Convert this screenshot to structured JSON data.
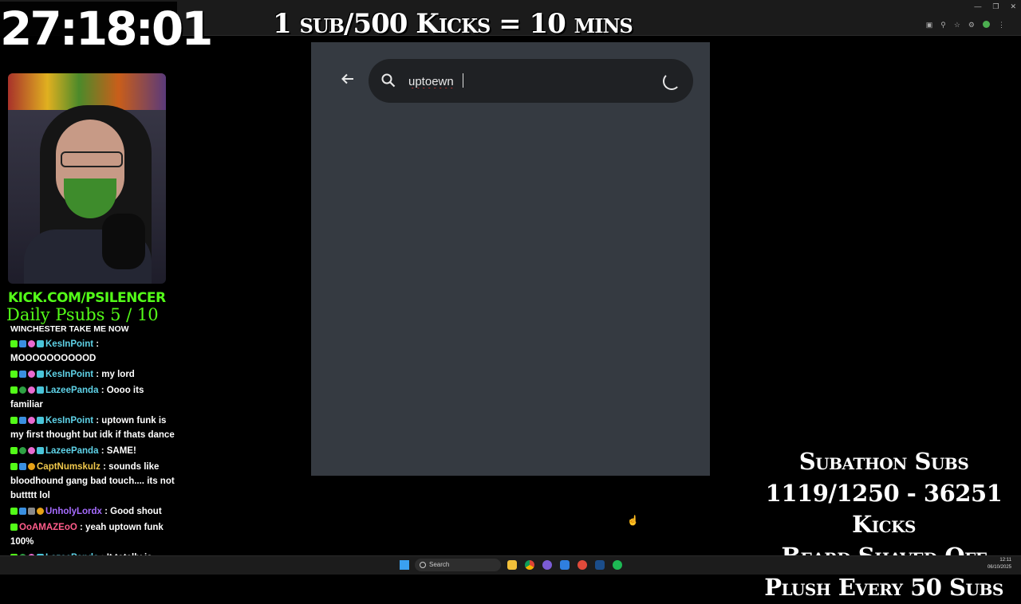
{
  "overlay": {
    "timer": "27:18:01",
    "goal_banner": "1 sub/500 Kicks = 10 mins",
    "kick_url": "KICK.COM/PSILENCER",
    "daily_psubs": "Daily Psubs 5 / 10",
    "subathon_lines": [
      "Subathon Subs",
      "1119/1250 - 36251 Kicks",
      "Beard Shaved Off",
      "Plush Every 50 Subs"
    ]
  },
  "chat": {
    "top_line": "WINCHESTER TAKE ME NOW",
    "messages": [
      {
        "user": "KesInPoint",
        "color": "#5fd3e8",
        "text": ": MOOOOOOOOOOD"
      },
      {
        "user": "KesInPoint",
        "color": "#5fd3e8",
        "text": ": my lord"
      },
      {
        "user": "LazeePanda",
        "color": "#5fd3e8",
        "text": ": Oooo its familiar"
      },
      {
        "user": "KesInPoint",
        "color": "#5fd3e8",
        "text": ": uptown funk is my first thought but idk if thats dance"
      },
      {
        "user": "LazeePanda",
        "color": "#5fd3e8",
        "text": ": SAME!"
      },
      {
        "user": "CaptNumskulz",
        "color": "#f2c94c",
        "text": ": sounds like bloodhound gang bad touch.... its not buttttt lol"
      },
      {
        "user": "UnholyLordx",
        "color": "#a66cff",
        "text": ": Good shout"
      },
      {
        "user": "OoAMAZEoO",
        "color": "#ff5c8a",
        "text": ": yeah uptown funk 100%"
      },
      {
        "user": "LazeePanda",
        "color": "#5fd3e8",
        "text": ": It totally is..."
      }
    ]
  },
  "search": {
    "query": "uptoewn"
  },
  "taskbar": {
    "search_label": "Search",
    "time": "12:11",
    "date": "06/10/2025"
  },
  "colors": {
    "kick_green": "#53fc18",
    "panel_bg": "#353a41",
    "search_box_bg": "#1f2124"
  }
}
